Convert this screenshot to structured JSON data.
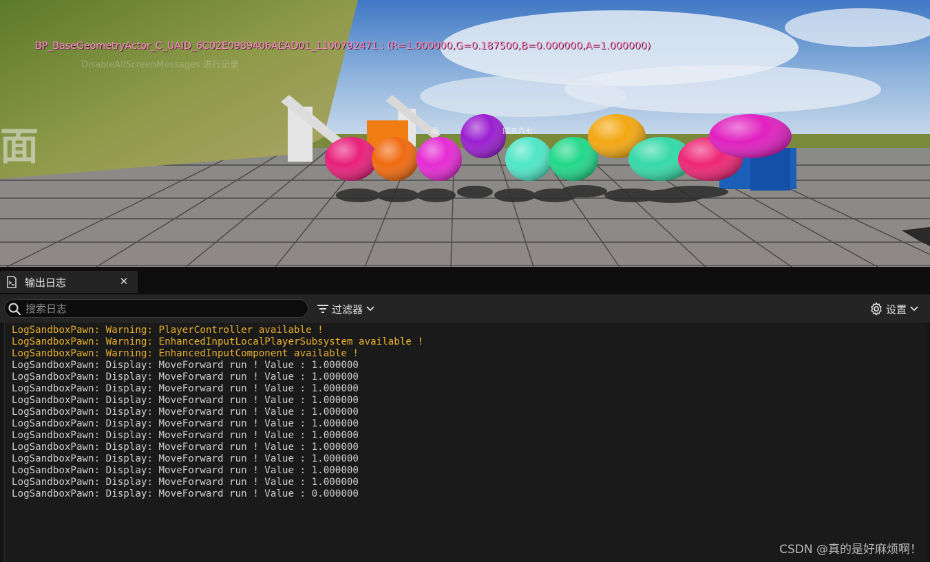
{
  "viewport": {
    "debug_message": "BP_BaseGeometryActor_C_UAID_6C02E0989406AEAD01_1100792471 : (R=1.000000,G=0.187500,B=0.000000,A=1.000000)",
    "ghost_message": "DisableAllScreenMessages 进行记录",
    "wall_glyph": "面",
    "scene_text_a": "画",
    "scene_text_b": "四五六七",
    "colors": {
      "sky": "#5f8fc8",
      "floor": "#8a8685",
      "grid": "#4c4a4a",
      "hill": "#7d8a3a",
      "debug_text": "#ff8ec9"
    },
    "spheres": [
      {
        "color": "#e8207a"
      },
      {
        "color": "#f06a10"
      },
      {
        "color": "#e52bd3"
      },
      {
        "color": "#9a1fd0"
      },
      {
        "color": "#4fe6c6"
      },
      {
        "color": "#22d88a"
      },
      {
        "color": "#f2a812"
      },
      {
        "color": "#35d9a7"
      },
      {
        "color": "#ee2676"
      },
      {
        "color": "#e020c0"
      }
    ]
  },
  "output_log": {
    "tab_label": "输出日志",
    "close_glyph": "✕",
    "search_placeholder": "搜索日志",
    "filter_label": "过滤器",
    "settings_label": "设置",
    "lines": [
      {
        "text": "LogSandboxPawn: Warning: PlayerController available !",
        "level": "warning"
      },
      {
        "text": "LogSandboxPawn: Warning: EnhancedInputLocalPlayerSubsystem available !",
        "level": "warning"
      },
      {
        "text": "LogSandboxPawn: Warning: EnhancedInputComponent available !",
        "level": "warning"
      },
      {
        "text": "LogSandboxPawn: Display: MoveForward run ! Value : 1.000000",
        "level": "display"
      },
      {
        "text": "LogSandboxPawn: Display: MoveForward run ! Value : 1.000000",
        "level": "display"
      },
      {
        "text": "LogSandboxPawn: Display: MoveForward run ! Value : 1.000000",
        "level": "display"
      },
      {
        "text": "LogSandboxPawn: Display: MoveForward run ! Value : 1.000000",
        "level": "display"
      },
      {
        "text": "LogSandboxPawn: Display: MoveForward run ! Value : 1.000000",
        "level": "display"
      },
      {
        "text": "LogSandboxPawn: Display: MoveForward run ! Value : 1.000000",
        "level": "display"
      },
      {
        "text": "LogSandboxPawn: Display: MoveForward run ! Value : 1.000000",
        "level": "display"
      },
      {
        "text": "LogSandboxPawn: Display: MoveForward run ! Value : 1.000000",
        "level": "display"
      },
      {
        "text": "LogSandboxPawn: Display: MoveForward run ! Value : 1.000000",
        "level": "display"
      },
      {
        "text": "LogSandboxPawn: Display: MoveForward run ! Value : 1.000000",
        "level": "display"
      },
      {
        "text": "LogSandboxPawn: Display: MoveForward run ! Value : 1.000000",
        "level": "display"
      },
      {
        "text": "LogSandboxPawn: Display: MoveForward run ! Value : 0.000000",
        "level": "display"
      }
    ],
    "warning_color": "#e8b02e",
    "display_color": "#cfcfcf"
  },
  "watermark": "CSDN @真的是好麻烦啊！"
}
